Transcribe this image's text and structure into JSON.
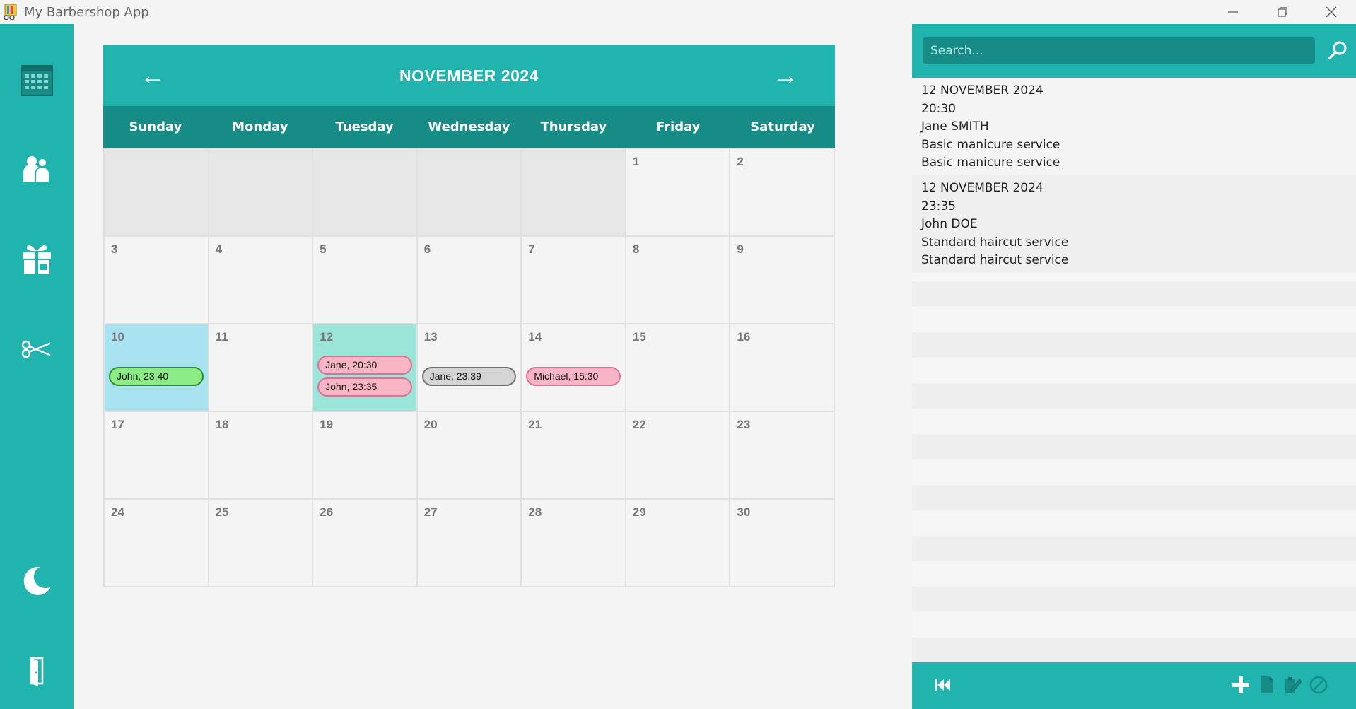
{
  "window": {
    "title": "My Barbershop App",
    "controls": [
      "minimize-icon",
      "restore-icon",
      "close-icon"
    ]
  },
  "colors": {
    "accent": "#21b3ad",
    "accent_dark": "#178c86",
    "event_green": "#8cec86",
    "event_pink": "#f7b5c6",
    "event_gray": "#d5d5d5",
    "selected_sunday": "#a9e2ef",
    "today": "#9be6d9"
  },
  "sidebar": {
    "items": [
      {
        "icon": "calendar-icon"
      },
      {
        "icon": "clients-icon"
      },
      {
        "icon": "gift-icon"
      },
      {
        "icon": "scissors-icon"
      },
      {
        "icon": "moon-icon"
      },
      {
        "icon": "exit-door-icon"
      }
    ]
  },
  "calendar": {
    "title": "NOVEMBER 2024",
    "prev_label": "←",
    "next_label": "→",
    "weekdays": [
      "Sunday",
      "Monday",
      "Tuesday",
      "Wednesday",
      "Thursday",
      "Friday",
      "Saturday"
    ],
    "days": [
      {
        "n": ""
      },
      {
        "n": ""
      },
      {
        "n": ""
      },
      {
        "n": ""
      },
      {
        "n": ""
      },
      {
        "n": "1"
      },
      {
        "n": "2"
      },
      {
        "n": "3"
      },
      {
        "n": "4"
      },
      {
        "n": "5"
      },
      {
        "n": "6"
      },
      {
        "n": "7"
      },
      {
        "n": "8"
      },
      {
        "n": "9"
      },
      {
        "n": "10",
        "state": "selected",
        "events": [
          {
            "label": "John, 23:40",
            "color": "green"
          }
        ]
      },
      {
        "n": "11"
      },
      {
        "n": "12",
        "state": "today",
        "events": [
          {
            "label": "Jane, 20:30",
            "color": "pink"
          },
          {
            "label": "John, 23:35",
            "color": "pink"
          }
        ]
      },
      {
        "n": "13",
        "events": [
          {
            "label": "Jane, 23:39",
            "color": "gray"
          }
        ]
      },
      {
        "n": "14",
        "events": [
          {
            "label": "Michael, 15:30",
            "color": "pink"
          }
        ]
      },
      {
        "n": "15"
      },
      {
        "n": "16"
      },
      {
        "n": "17"
      },
      {
        "n": "18"
      },
      {
        "n": "19"
      },
      {
        "n": "20"
      },
      {
        "n": "21"
      },
      {
        "n": "22"
      },
      {
        "n": "23"
      },
      {
        "n": "24"
      },
      {
        "n": "25"
      },
      {
        "n": "26"
      },
      {
        "n": "27"
      },
      {
        "n": "28"
      },
      {
        "n": "29"
      },
      {
        "n": "30"
      }
    ]
  },
  "panel": {
    "search_placeholder": "Search...",
    "appointments": [
      {
        "date": "12 NOVEMBER 2024",
        "time": "20:30",
        "client": "Jane SMITH",
        "service": "Basic manicure service",
        "service2": "Basic manicure service"
      },
      {
        "date": "12 NOVEMBER 2024",
        "time": "23:35",
        "client": "John DOE",
        "service": "Standard haircut service",
        "service2": "Standard haircut service"
      }
    ],
    "footer_icons": [
      "skip-back-icon",
      "add-icon",
      "document-icon",
      "edit-document-icon",
      "cancel-icon"
    ]
  }
}
